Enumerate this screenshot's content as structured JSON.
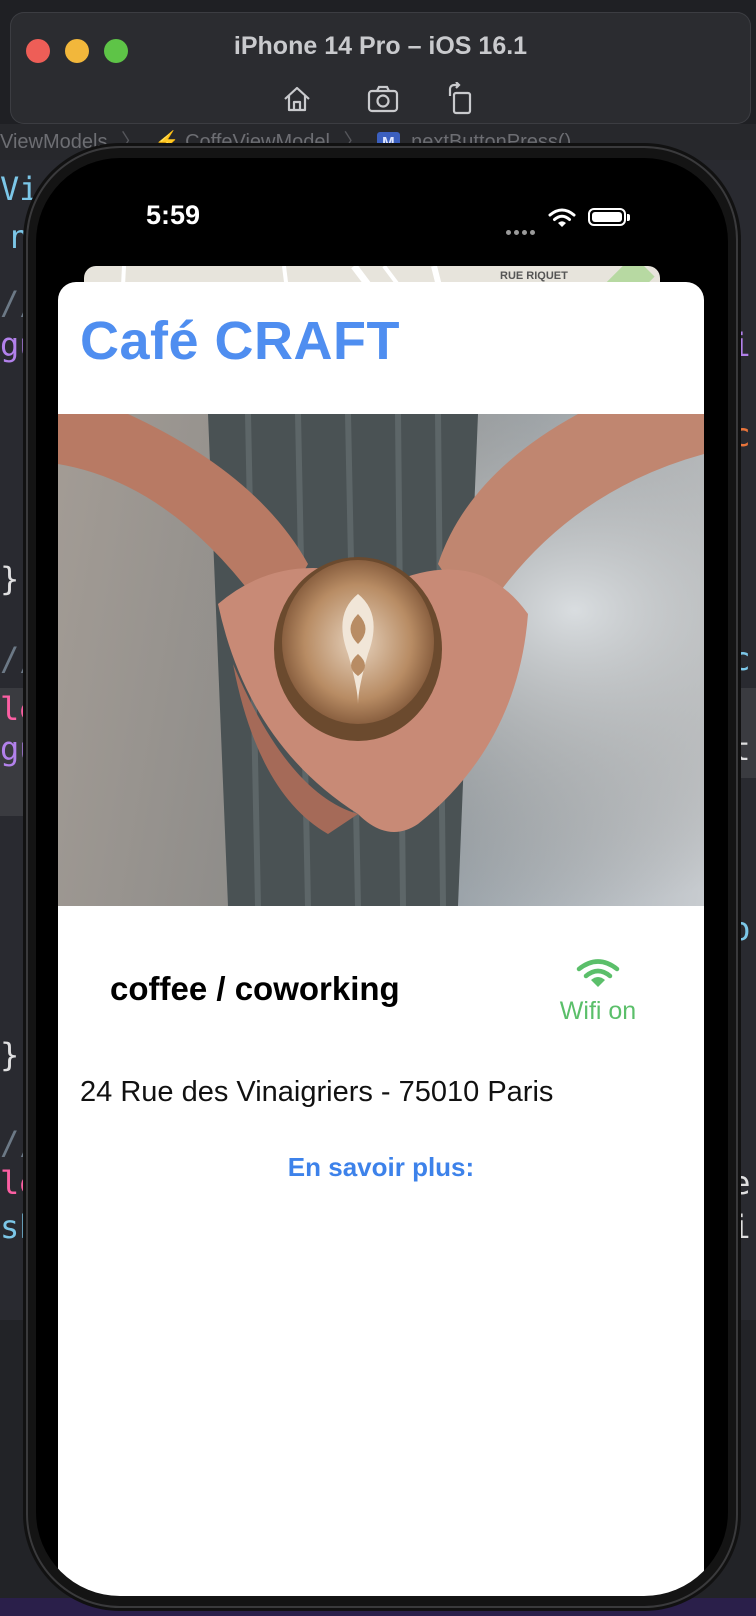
{
  "simulator": {
    "title": "iPhone 14 Pro – iOS 16.1",
    "tools": [
      "home-icon",
      "screenshot-icon",
      "rotate-icon"
    ]
  },
  "xcode": {
    "breadcrumb": [
      "ViewModels",
      "CoffeViewModel",
      "nextButtonPress()"
    ]
  },
  "status_bar": {
    "time": "5:59"
  },
  "map": {
    "road_labels": [
      "RUE RIQUET"
    ]
  },
  "cafe": {
    "name": "Café CRAFT",
    "category": "coffee / coworking",
    "wifi_label": "Wifi on",
    "address": "24 Rue des Vinaigriers - 75010 Paris",
    "more_link": "En savoir plus:"
  },
  "colors": {
    "accent_blue": "#4f8ef0",
    "wifi_green": "#5bbf6a",
    "link_blue": "#3d82ea"
  }
}
